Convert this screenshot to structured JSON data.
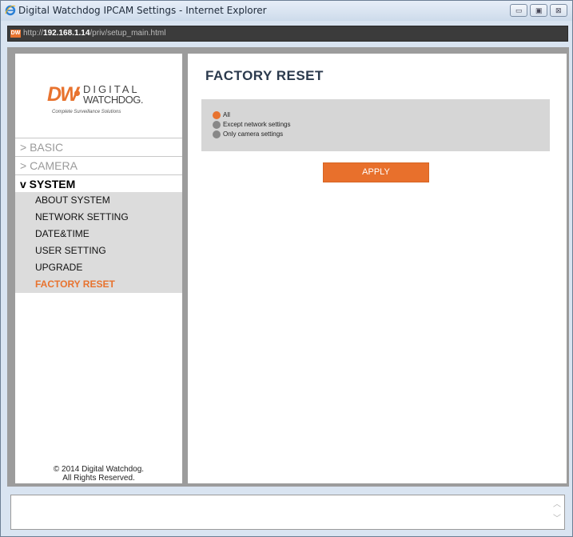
{
  "window": {
    "title": "Digital Watchdog IPCAM Settings - Internet Explorer"
  },
  "address_bar": {
    "icon": "DW",
    "url_prefix": "http://",
    "url_host": "192.168.1.14",
    "url_path": "/priv/setup_main.html"
  },
  "sidebar": {
    "logo": {
      "mark": "DW",
      "line1": "DIGITAL",
      "line2": "WATCHDOG.",
      "tagline": "Complete Surveillance Solutions"
    },
    "menu": [
      {
        "label": "> BASIC"
      },
      {
        "label": "> CAMERA"
      },
      {
        "label": "v SYSTEM"
      }
    ],
    "system_items": [
      {
        "label": "ABOUT SYSTEM"
      },
      {
        "label": "NETWORK SETTING"
      },
      {
        "label": "DATE&TIME"
      },
      {
        "label": "USER SETTING"
      },
      {
        "label": "UPGRADE"
      },
      {
        "label": "FACTORY RESET"
      }
    ],
    "copyright_line1": "© 2014 Digital Watchdog.",
    "copyright_line2": "All Rights Reserved."
  },
  "main": {
    "title": "FACTORY RESET",
    "options": [
      {
        "label": "All",
        "selected": true
      },
      {
        "label": "Except network settings",
        "selected": false
      },
      {
        "label": "Only camera settings",
        "selected": false
      }
    ],
    "apply_label": "APPLY"
  },
  "colors": {
    "accent": "#e8732f",
    "sidebar_active_bg": "#dcdcdc",
    "content_bg": "#9c9c9c"
  }
}
